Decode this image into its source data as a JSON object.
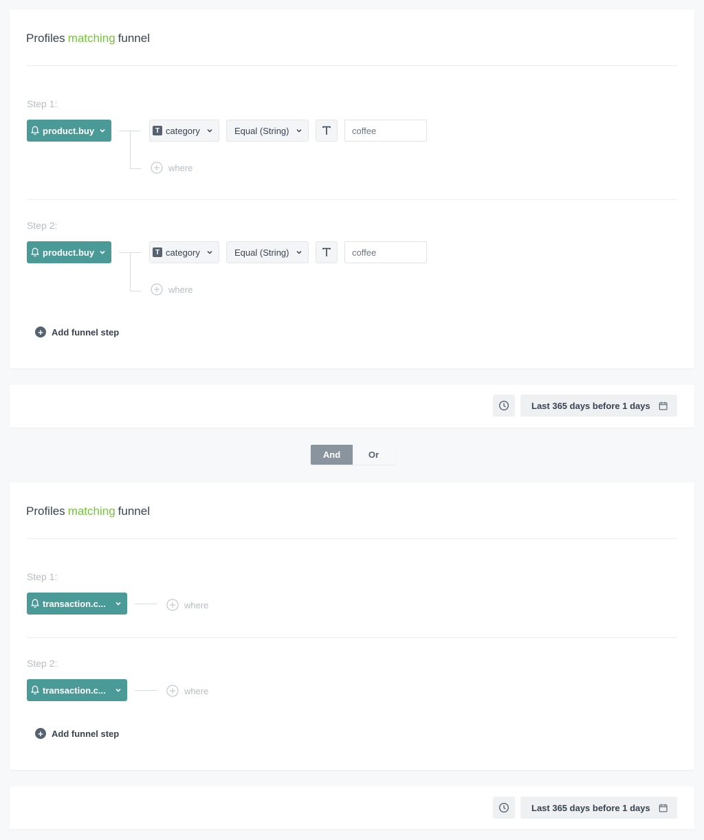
{
  "funnel1": {
    "title": {
      "a": "Profiles",
      "b": "matching",
      "c": "funnel"
    },
    "steps": [
      {
        "label": "Step 1:",
        "event": "product.buy",
        "param": "category",
        "operator": "Equal (String)",
        "value": "coffee",
        "where": "where"
      },
      {
        "label": "Step 2:",
        "event": "product.buy",
        "param": "category",
        "operator": "Equal (String)",
        "value": "coffee",
        "where": "where"
      }
    ],
    "add_step": "Add funnel step",
    "date_range": "Last 365 days before 1 days"
  },
  "logic_toggle": {
    "and": "And",
    "or": "Or",
    "selected": "And"
  },
  "funnel2": {
    "title": {
      "a": "Profiles",
      "b": "matching",
      "c": "funnel"
    },
    "steps": [
      {
        "label": "Step 1:",
        "event": "transaction.c...",
        "where": "where"
      },
      {
        "label": "Step 2:",
        "event": "transaction.c...",
        "where": "where"
      }
    ],
    "add_step": "Add funnel step",
    "date_range": "Last 365 days before 1 days"
  },
  "colors": {
    "accent_green": "#76c341",
    "event_teal": "#4a9a97",
    "toggle_active": "#8a949e"
  }
}
